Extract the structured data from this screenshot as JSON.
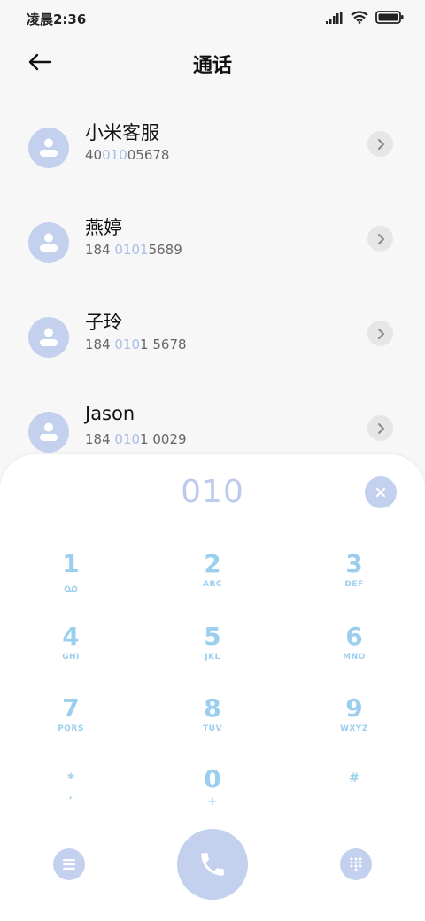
{
  "status_bar": {
    "time": "凌晨2:36"
  },
  "header": {
    "title": "通话"
  },
  "contacts": [
    {
      "name": "小米客服",
      "number_parts": [
        "40",
        "010",
        "05678"
      ]
    },
    {
      "name": "燕婷",
      "number_parts": [
        "184 ",
        "0101",
        "5689"
      ]
    },
    {
      "name": "子玲",
      "number_parts": [
        "184 ",
        "010",
        "1 5678"
      ]
    },
    {
      "name": "Jason",
      "number_parts": [
        "184 ",
        "010",
        "1 0029"
      ]
    }
  ],
  "dialpad": {
    "input_value": "010",
    "keys": [
      {
        "digit": "1",
        "letters": ""
      },
      {
        "digit": "2",
        "letters": "ABC"
      },
      {
        "digit": "3",
        "letters": "DEF"
      },
      {
        "digit": "4",
        "letters": "GHI"
      },
      {
        "digit": "5",
        "letters": "JKL"
      },
      {
        "digit": "6",
        "letters": "MNO"
      },
      {
        "digit": "7",
        "letters": "PQRS"
      },
      {
        "digit": "8",
        "letters": "TUV"
      },
      {
        "digit": "9",
        "letters": "WXYZ"
      },
      {
        "digit": "*",
        "letters": ","
      },
      {
        "digit": "0",
        "letters": "+"
      },
      {
        "digit": "#",
        "letters": ""
      }
    ]
  },
  "icons": {
    "back": "arrow-left-icon",
    "contact_avatar": "person-icon",
    "detail": "chevron-right-icon",
    "clear": "close-icon",
    "voicemail": "voicemail-icon",
    "menu": "menu-icon",
    "call": "phone-icon",
    "keypad": "keypad-grid-icon"
  },
  "colors": {
    "accent": "#c3d0ee",
    "key_text": "#9ccfee",
    "highlight": "#a9bde8"
  }
}
